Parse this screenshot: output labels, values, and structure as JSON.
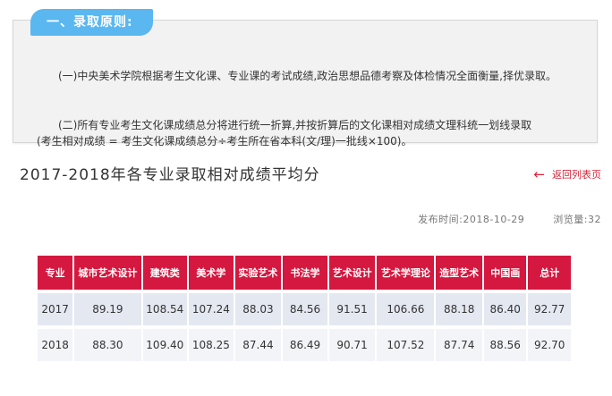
{
  "notice": {
    "tag": "一、录取原则:",
    "para1": "(一)中央美术学院根据考生文化课、专业课的考试成绩,政治思想品德考察及体检情况全面衡量,择优录取。",
    "para2_line1": "(二)所有专业考生文化课成绩总分将进行统一折算,并按折算后的文化课相对成绩文理科统一划线录取",
    "para2_line2": "(考生相对成绩 = 考生文化课成绩总分÷考生所在省本科(文/理)一批线×100)。"
  },
  "article": {
    "title": "2017-2018年各专业录取相对成绩平均分",
    "back_label": "返回列表页",
    "publish_time": "发布时间:2018-10-29",
    "views": "浏览量:32"
  },
  "table": {
    "headers": [
      "专业",
      "城市艺术设计",
      "建筑类",
      "美术学",
      "实验艺术",
      "书法学",
      "艺术设计",
      "艺术学理论",
      "造型艺术",
      "中国画",
      "总计"
    ],
    "rows": [
      [
        "2017",
        "89.19",
        "108.54",
        "107.24",
        "88.03",
        "84.56",
        "91.51",
        "106.66",
        "88.18",
        "86.40",
        "92.77"
      ],
      [
        "2018",
        "88.30",
        "109.40",
        "108.25",
        "87.44",
        "86.49",
        "90.71",
        "107.52",
        "87.74",
        "88.56",
        "92.70"
      ]
    ]
  },
  "colors": {
    "tag_bg": "#5ab7f0",
    "header_bg": "#d4183f",
    "accent": "#d6243a"
  },
  "icons": {
    "back": "left-arrow-icon"
  }
}
